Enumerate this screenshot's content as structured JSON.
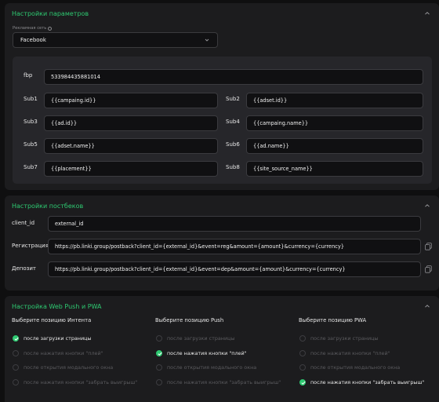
{
  "params": {
    "title": "Настройки параметров",
    "ad_network_label": "Рекламная сеть",
    "ad_network_value": "Facebook",
    "fbp_label": "fbp",
    "fbp_value": "533984435881014",
    "subs": [
      {
        "label": "Sub1",
        "value": "{{campaing.id}}"
      },
      {
        "label": "Sub2",
        "value": "{{adset.id}}"
      },
      {
        "label": "Sub3",
        "value": "{{ad.id}}"
      },
      {
        "label": "Sub4",
        "value": "{{campaing.name}}"
      },
      {
        "label": "Sub5",
        "value": "{{adset.name}}"
      },
      {
        "label": "Sub6",
        "value": "{{ad.name}}"
      },
      {
        "label": "Sub7",
        "value": "{{placement}}"
      },
      {
        "label": "Sub8",
        "value": "{{site_source_name}}"
      }
    ]
  },
  "postbacks": {
    "title": "Настройки постбеков",
    "client_id_label": "client_id",
    "client_id_value": "external_id",
    "registration_label": "Регистрация",
    "registration_value": "https://pb.linki.group/postback?client_id={external_id}&event=reg&amount={amount}&currency={currency}",
    "deposit_label": "Депозит",
    "deposit_value": "https://pb.linki.group/postback?client_id={external_id}&event=dep&amount={amount}&currency={currency}"
  },
  "push": {
    "title": "Настройка Web Push и PWA",
    "columns": [
      {
        "title": "Выберите позицию Интента",
        "selected": 0
      },
      {
        "title": "Выберите позицию Push",
        "selected": 1
      },
      {
        "title": "Выберите позицию PWA",
        "selected": 3
      }
    ],
    "options": [
      "после загрузки страницы",
      "после нажатия кнопки \"плей\"",
      "после открытия модального окна",
      "после нажатия кнопки \"забрать выигрыш\""
    ]
  },
  "colors": {
    "accent": "#2ec971",
    "panel": "#1c1c1e",
    "background": "#0f0f10"
  }
}
